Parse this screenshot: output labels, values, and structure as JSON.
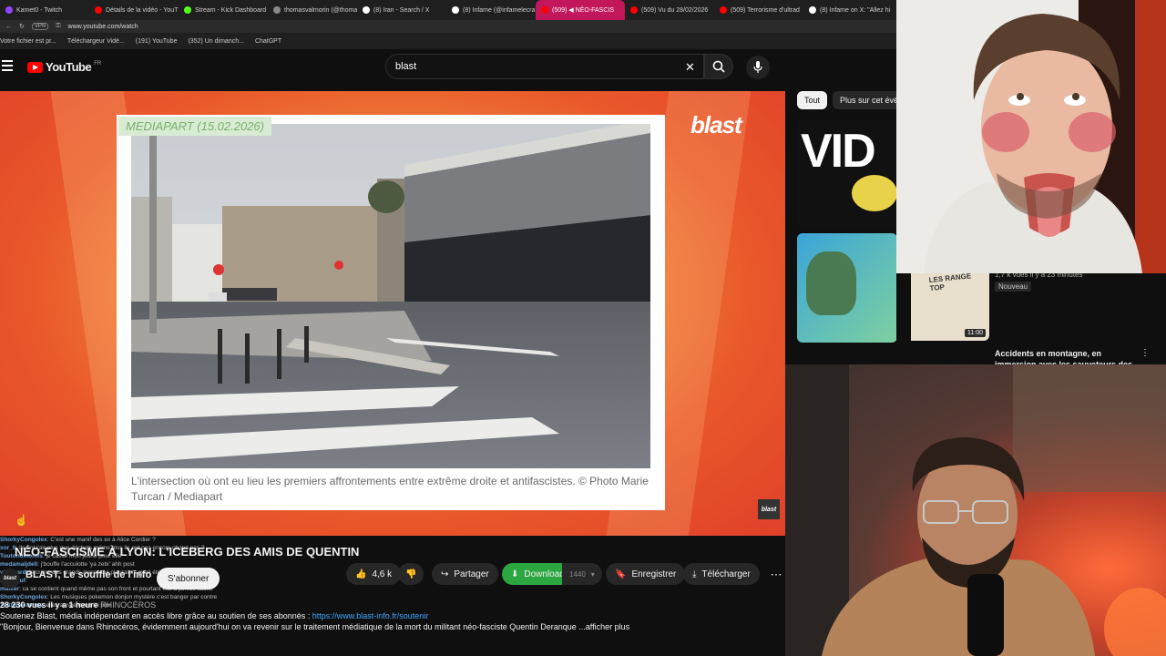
{
  "browser": {
    "tabs": [
      {
        "label": "Kamet0 - Twitch",
        "color": "#9146ff",
        "active": false
      },
      {
        "label": "Détails de la vidéo - YouT",
        "color": "#ff0000",
        "active": false
      },
      {
        "label": "Stream - Kick Dashboard",
        "color": "#53fc18",
        "active": false
      },
      {
        "label": "thomasvalmorin (@thoma",
        "color": "#888888",
        "active": false
      },
      {
        "label": "(8) Iran - Search / X",
        "color": "#ffffff",
        "active": false
      },
      {
        "label": "(8) Infame (@infamelecra",
        "color": "#ffffff",
        "active": false
      },
      {
        "label": "(509) ◀ NÉO-FASCIS",
        "color": "#ff0000",
        "active": true
      },
      {
        "label": "(509) Vu du 28/02/2026",
        "color": "#ff0000",
        "active": false
      },
      {
        "label": "(509) Terrorisme d'ultrad",
        "color": "#ff0000",
        "active": false
      },
      {
        "label": "(8) Infame on X: \"Allez hi",
        "color": "#ffffff",
        "active": false
      }
    ],
    "url": "www.youtube.com/watch",
    "bookmarks": [
      "Votre fichier est pr...",
      "Téléchargeur Vidé...",
      "(191) YouTube",
      "(352) Un dimanch...",
      "ChatGPT"
    ]
  },
  "youtube": {
    "logo_text": "YouTube",
    "logo_region": "FR",
    "search_value": "blast",
    "icons": {
      "menu": "menu-icon",
      "clear": "close-icon",
      "search": "search-icon",
      "mic": "mic-icon"
    }
  },
  "video": {
    "card_tag": "MEDIAPART (15.02.2026)",
    "caption": "L'intersection où ont eu lieu les premiers affrontements entre extrême droite et antifascistes. © Photo Marie Turcan / Mediapart",
    "brand": "blast",
    "badge": "blast"
  },
  "info": {
    "title": "NÉO-FASCISME À LYON: L'ICEBERG DES AMIS DE QUENTIN",
    "channel_name": "BLAST, Le souffle de l'info",
    "channel_avatar": "blast",
    "subscribe": "S'abonner",
    "likes": "4,6 k",
    "share": "Partager",
    "download": "Download",
    "download_count": "1440",
    "save": "Enregistrer",
    "telecharger": "Télécharger",
    "more": "⋯",
    "stats": "28 230 vues  il y a 1 heure",
    "tags": "RHINOCÉROS",
    "support_text": "Soutenez Blast,  média indépendant en accès libre grâce au soutien de ses abonnés : ",
    "support_link": "https://www.blast-info.fr/soutenir",
    "desc_line": "\"Bonjour, Bienvenue dans Rhinocéros, évidemment aujourd'hui on va revenir sur le traitement médiatique de la mort du militant néo-fasciste Quentin Deranque ...afficher plus"
  },
  "chat": [
    {
      "user": "ShorkyCongolex",
      "msg": "C'est une manif des ex à Alice Cordier ?"
    },
    {
      "user": "xor_0",
      "msg": "Ils ont l'air plus que déchets même plus ils ont pas encore chopé pas ?"
    },
    {
      "user": "Toutonoktonos",
      "msg": "je casse mon jeune pour elle"
    },
    {
      "user": "medamaijdell",
      "msg": "j'bouffe l'acculotte 'ya zebi' ahh post"
    },
    {
      "user": "vladikard",
      "msg": "le crane des grands meres qui pleuraient avait été rasés en 45"
    },
    {
      "user": "Nemeguf",
      "msg": ""
    },
    {
      "user": "maiker",
      "msg": "ca se contient quand même pas son front et pourtant elle a jamais cache"
    },
    {
      "user": "ShorkyCongolex",
      "msg": "Les musiques pokemon donjon mystère c'est banger par contre"
    },
    {
      "user": "Toutonoktonos",
      "msg": "elles auraient mérité pire"
    }
  ],
  "sidebar": {
    "chips": [
      "Tout",
      "Plus sur cet évé"
    ],
    "items": [
      {
        "meta": "1,7 k vues  il y a 23 minutes",
        "badge": "Nouveau",
        "duration": "11:00",
        "thumb_text": "LES RANGE TOP"
      },
      {
        "title": "Accidents en montagne, en immersion avec les sauveteurs des",
        "thumb_text": "VID"
      }
    ]
  },
  "colors": {
    "accent": "#ff0000",
    "download_green": "#2ba640",
    "link": "#3ea6ff",
    "card_tag_bg": "#d8ecd4",
    "card_tag_fg": "#7ab06d"
  }
}
